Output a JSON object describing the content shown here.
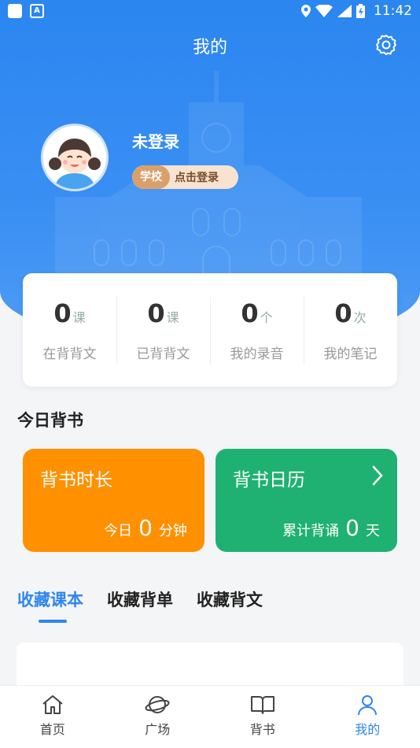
{
  "status_bar": {
    "time": "11:42",
    "app_icon_letter": "A"
  },
  "header": {
    "title": "我的",
    "settings_icon": "gear-icon"
  },
  "profile": {
    "username": "未登录",
    "school_tag": "学校",
    "login_prompt": "点击登录"
  },
  "stats": [
    {
      "value": "0",
      "unit": "课",
      "label": "在背背文"
    },
    {
      "value": "0",
      "unit": "课",
      "label": "已背背文"
    },
    {
      "value": "0",
      "unit": "个",
      "label": "我的录音"
    },
    {
      "value": "0",
      "unit": "次",
      "label": "我的笔记"
    }
  ],
  "today": {
    "section_title": "今日背书",
    "duration_card": {
      "title": "背书时长",
      "prefix": "今日",
      "value": "0",
      "suffix": "分钟",
      "color": "#ff9000"
    },
    "calendar_card": {
      "title": "背书日历",
      "prefix": "累计背诵",
      "value": "0",
      "suffix": "天",
      "color": "#1fb171"
    }
  },
  "collection_tabs": [
    {
      "label": "收藏课本",
      "active": true
    },
    {
      "label": "收藏背单",
      "active": false
    },
    {
      "label": "收藏背文",
      "active": false
    }
  ],
  "bottom_nav": [
    {
      "label": "首页",
      "icon": "home-icon"
    },
    {
      "label": "广场",
      "icon": "planet-icon"
    },
    {
      "label": "背书",
      "icon": "book-icon"
    },
    {
      "label": "我的",
      "icon": "user-icon",
      "active": true
    }
  ],
  "colors": {
    "primary": "#2f86ee",
    "orange": "#ff9000",
    "green": "#1fb171"
  }
}
